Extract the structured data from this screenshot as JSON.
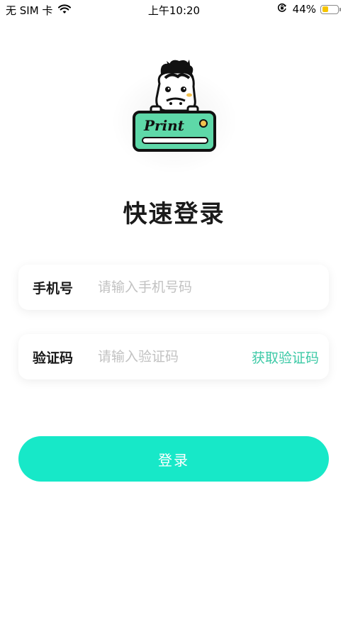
{
  "status_bar": {
    "carrier": "无 SIM 卡",
    "time": "上午10:20",
    "battery_percent": "44%",
    "battery_level": 0.44,
    "battery_color": "#f5c400"
  },
  "logo": {
    "text": "Print"
  },
  "title": "快速登录",
  "phone_field": {
    "label": "手机号",
    "placeholder": "请输入手机号码",
    "value": ""
  },
  "code_field": {
    "label": "验证码",
    "placeholder": "请输入验证码",
    "value": "",
    "get_code_label": "获取验证码"
  },
  "login_button": {
    "label": "登录"
  },
  "colors": {
    "accent": "#17e8c8",
    "link": "#3cc9a6",
    "logo_green": "#5ed8a8"
  }
}
